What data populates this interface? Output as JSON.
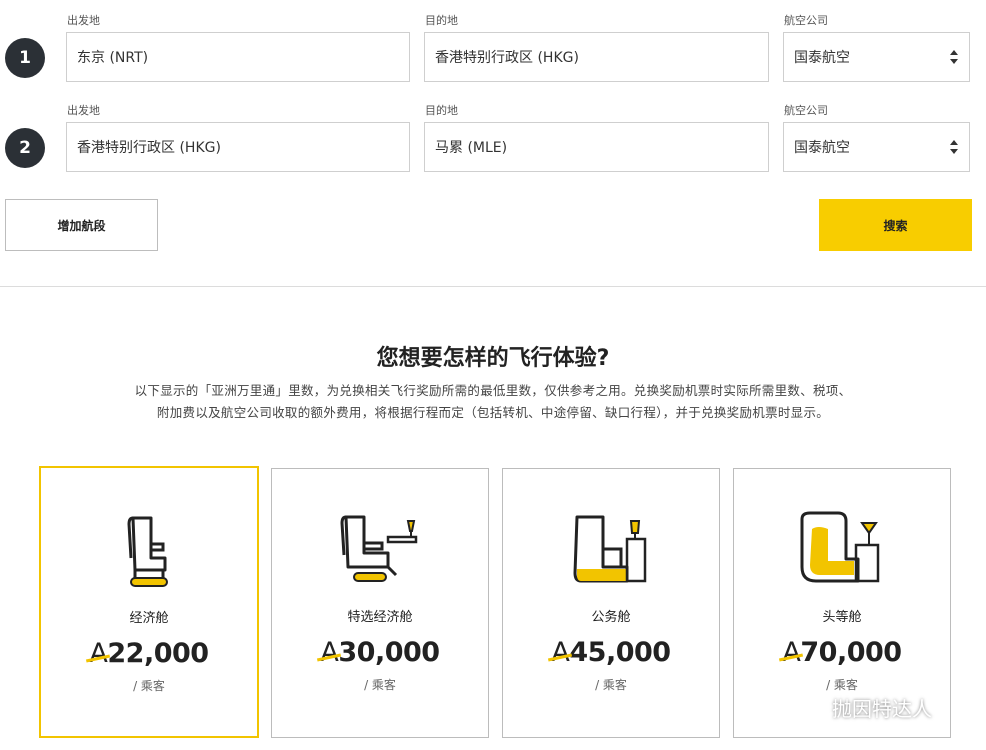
{
  "segments": [
    {
      "number": "1",
      "origin_label": "出发地",
      "origin_value": "东京 (NRT)",
      "destination_label": "目的地",
      "destination_value": "香港特别行政区 (HKG)",
      "airline_label": "航空公司",
      "airline_value": "国泰航空"
    },
    {
      "number": "2",
      "origin_label": "出发地",
      "origin_value": "香港特别行政区 (HKG)",
      "destination_label": "目的地",
      "destination_value": "马累 (MLE)",
      "airline_label": "航空公司",
      "airline_value": "国泰航空"
    }
  ],
  "buttons": {
    "add_segment": "增加航段",
    "search": "搜索"
  },
  "section": {
    "title": "您想要怎样的飞行体验?",
    "description_line1": "以下显示的「亚洲万里通」里数，为兑换相关飞行奖励所需的最低里数，仅供参考之用。兑换奖励机票时实际所需里数、税项、",
    "description_line2": "附加费以及航空公司收取的额外费用，将根据行程而定（包括转机、中途停留、缺口行程），并于兑换奖励机票时显示。"
  },
  "cabins": [
    {
      "name": "经济舱",
      "symbol": "A",
      "miles": "22,000",
      "unit": "/ 乘客",
      "selected": true,
      "icon": "economy-seat-icon"
    },
    {
      "name": "特选经济舱",
      "symbol": "A",
      "miles": "30,000",
      "unit": "/ 乘客",
      "selected": false,
      "icon": "premium-economy-seat-icon"
    },
    {
      "name": "公务舱",
      "symbol": "A",
      "miles": "45,000",
      "unit": "/ 乘客",
      "selected": false,
      "icon": "business-seat-icon"
    },
    {
      "name": "头等舱",
      "symbol": "A",
      "miles": "70,000",
      "unit": "/ 乘客",
      "selected": false,
      "icon": "first-class-seat-icon"
    }
  ],
  "watermark": {
    "text": "抛因特达人",
    "icon": "wechat-icon"
  },
  "colors": {
    "accent": "#f8cd00",
    "segment_badge": "#2b3036"
  }
}
